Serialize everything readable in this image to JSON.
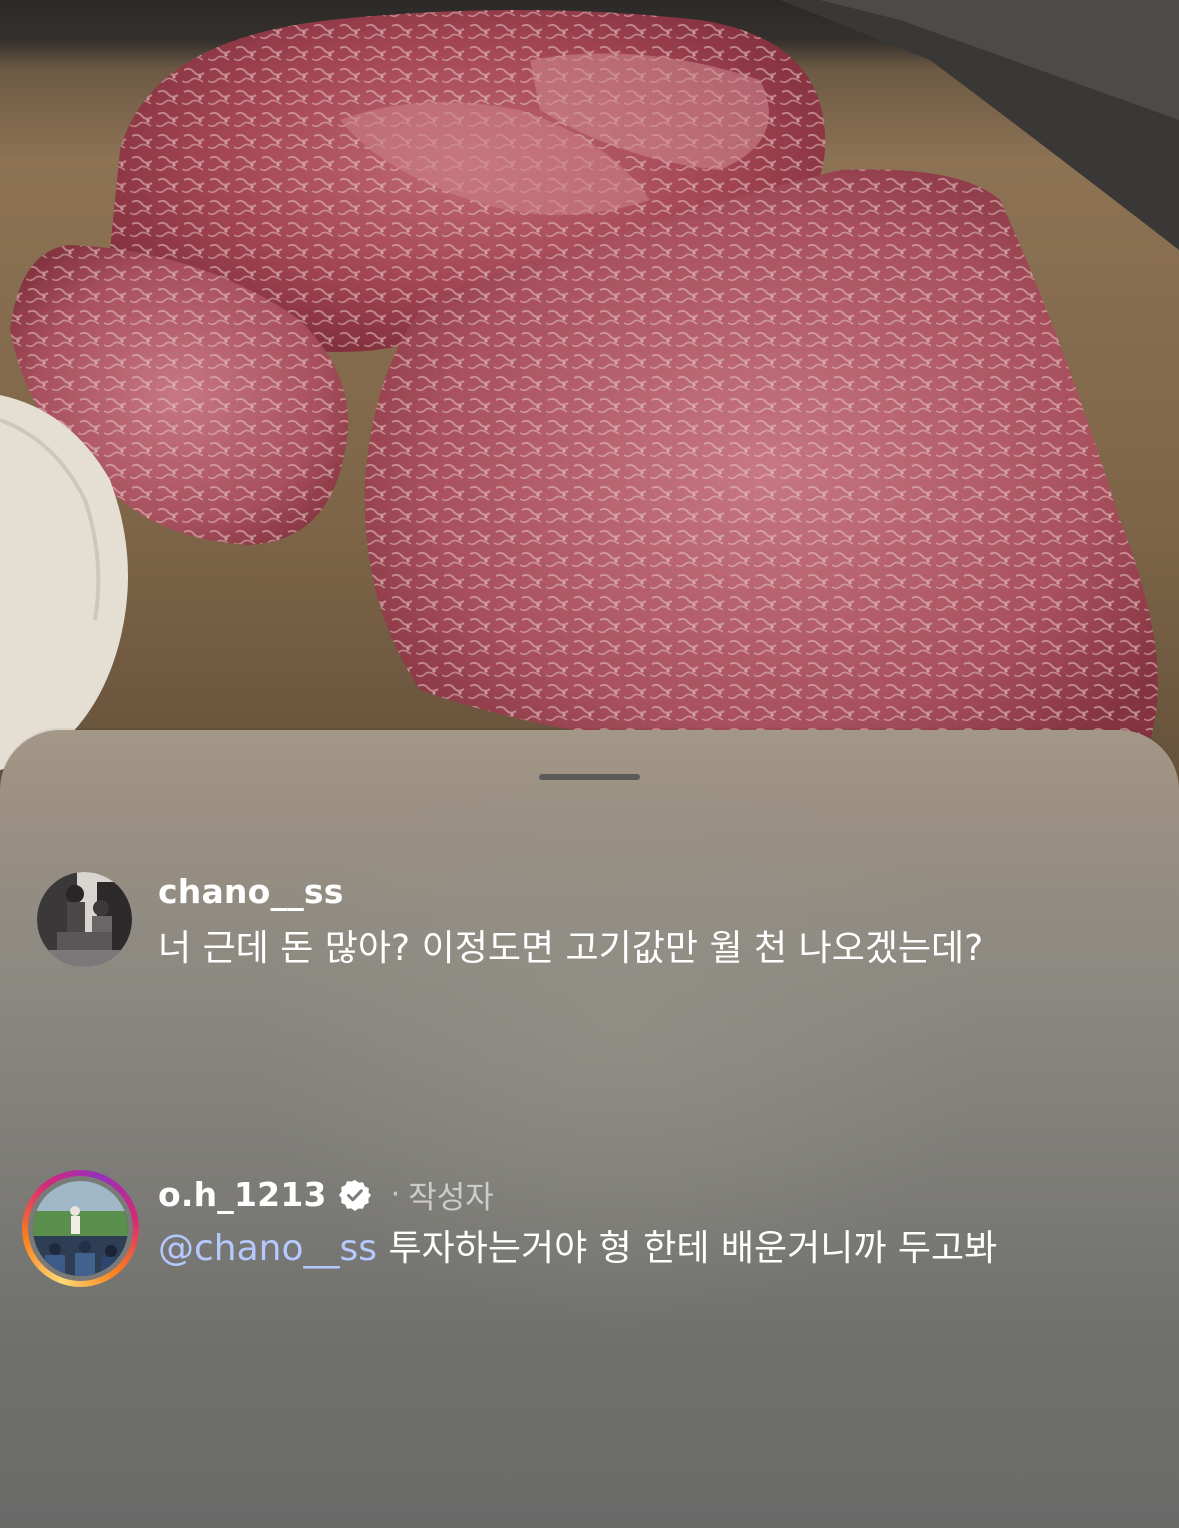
{
  "sheet": {
    "comments": [
      {
        "username": "chano__ss",
        "text": "너 근데 돈 많아? 이정도면 고기값만 월 천 나오겠는데?",
        "avatar": "avatar-photo"
      },
      {
        "username": "o.h_1213",
        "verified": true,
        "separator": "·",
        "author_tag": "작성자",
        "mention": "@chano__ss",
        "text": " 투자하는거야 형 한테 배운거니까 두고봐",
        "avatar": "avatar-photo-story-ring"
      }
    ]
  },
  "colors": {
    "mention": "#b5c9ff",
    "sheet_top": "#a39786",
    "sheet_bottom": "#6a6a69",
    "story_ring": [
      "#feda75",
      "#fa7e1e",
      "#d62976",
      "#962fbf"
    ]
  }
}
